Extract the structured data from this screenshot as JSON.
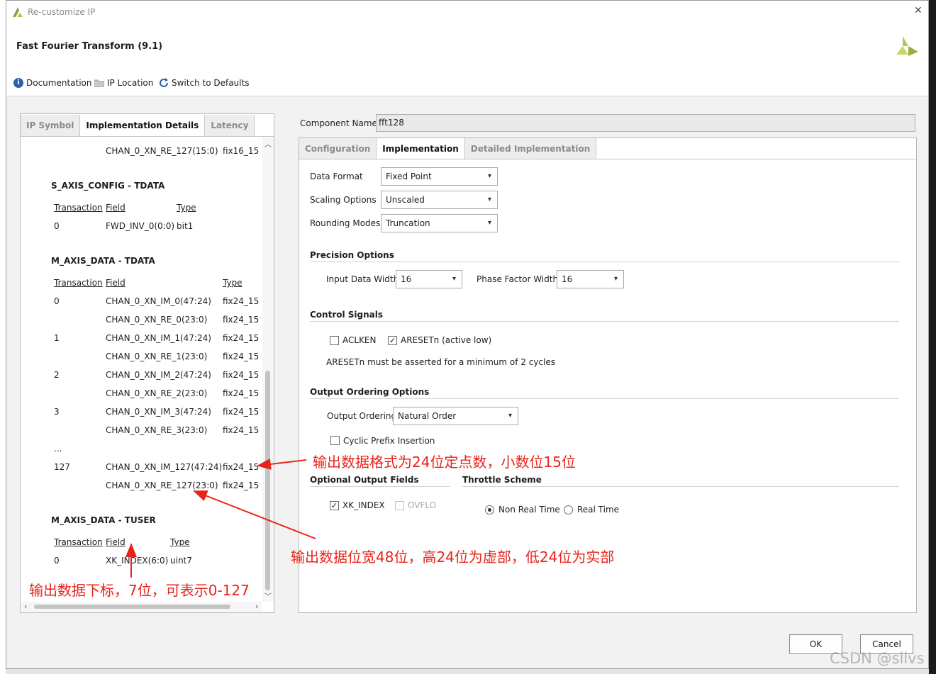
{
  "window": {
    "title": "Re-customize IP",
    "close": "✕",
    "heading": "Fast Fourier Transform (9.1)"
  },
  "toolbar": {
    "documentation": "Documentation",
    "ip_location": "IP Location",
    "switch_defaults": "Switch to Defaults"
  },
  "left": {
    "tabs": [
      "IP Symbol",
      "Implementation Details",
      "Latency"
    ],
    "active_tab": "Implementation Details",
    "top_row": {
      "field": "CHAN_0_XN_RE_127(15:0)",
      "type": "fix16_15"
    },
    "config_section": {
      "title": "S_AXIS_CONFIG - TDATA",
      "headers": [
        "Transaction",
        "Field",
        "Type"
      ],
      "rows": [
        {
          "txn": "0",
          "field": "FWD_INV_0(0:0)",
          "type": "bit1"
        }
      ]
    },
    "data_section": {
      "title": "M_AXIS_DATA - TDATA",
      "headers": [
        "Transaction",
        "Field",
        "Type"
      ],
      "rows": [
        {
          "txn": "0",
          "field": "CHAN_0_XN_IM_0(47:24)",
          "type": "fix24_15"
        },
        {
          "txn": "",
          "field": "CHAN_0_XN_RE_0(23:0)",
          "type": "fix24_15"
        },
        {
          "txn": "1",
          "field": "CHAN_0_XN_IM_1(47:24)",
          "type": "fix24_15"
        },
        {
          "txn": "",
          "field": "CHAN_0_XN_RE_1(23:0)",
          "type": "fix24_15"
        },
        {
          "txn": "2",
          "field": "CHAN_0_XN_IM_2(47:24)",
          "type": "fix24_15"
        },
        {
          "txn": "",
          "field": "CHAN_0_XN_RE_2(23:0)",
          "type": "fix24_15"
        },
        {
          "txn": "3",
          "field": "CHAN_0_XN_IM_3(47:24)",
          "type": "fix24_15"
        },
        {
          "txn": "",
          "field": "CHAN_0_XN_RE_3(23:0)",
          "type": "fix24_15"
        },
        {
          "txn": "...",
          "field": "",
          "type": ""
        },
        {
          "txn": "127",
          "field": "CHAN_0_XN_IM_127(47:24)",
          "type": "fix24_15"
        },
        {
          "txn": "",
          "field": "CHAN_0_XN_RE_127(23:0)",
          "type": "fix24_15"
        }
      ]
    },
    "tuser_section": {
      "title": "M_AXIS_DATA - TUSER",
      "headers": [
        "Transaction",
        "Field",
        "Type"
      ],
      "rows": [
        {
          "txn": "0",
          "field": "XK_INDEX(6:0)",
          "type": "uint7"
        }
      ]
    }
  },
  "right": {
    "component_name_label": "Component Name",
    "component_name_value": "fft128",
    "tabs": [
      "Configuration",
      "Implementation",
      "Detailed Implementation"
    ],
    "active_tab": "Implementation",
    "data_format": {
      "label": "Data Format",
      "value": "Fixed Point"
    },
    "scaling": {
      "label": "Scaling Options",
      "value": "Unscaled"
    },
    "rounding": {
      "label": "Rounding Modes",
      "value": "Truncation"
    },
    "precision": {
      "title": "Precision Options",
      "input_width_label": "Input Data Width",
      "input_width": "16",
      "phase_width_label": "Phase Factor Width",
      "phase_width": "16"
    },
    "control": {
      "title": "Control Signals",
      "aclken": {
        "label": "ACLKEN",
        "checked": false
      },
      "aresetn": {
        "label": "ARESETn (active low)",
        "checked": true
      },
      "note": "ARESETn must be asserted for a minimum of 2 cycles"
    },
    "ordering": {
      "title": "Output Ordering Options",
      "label": "Output Ordering",
      "value": "Natural Order",
      "cyclic": {
        "label": "Cyclic Prefix Insertion",
        "checked": false
      }
    },
    "optional": {
      "title": "Optional Output Fields",
      "xk_index": {
        "label": "XK_INDEX",
        "checked": true
      },
      "ovflo": {
        "label": "OVFLO",
        "checked": false
      }
    },
    "throttle": {
      "title": "Throttle Scheme",
      "non_real_time": "Non Real Time",
      "real_time": "Real Time",
      "selected": "Non Real Time"
    }
  },
  "buttons": {
    "ok": "OK",
    "cancel": "Cancel"
  },
  "annotations": {
    "format": "输出数据格式为24位定点数，小数位15位",
    "width": "输出数据位宽48位，高24位为虚部，低24位为实部",
    "index": "输出数据下标，7位，可表示0-127"
  },
  "watermark": "CSDN @sllvs",
  "colors": {
    "annotation": "#e8231a",
    "xilinx_logo": "#b6c94a"
  }
}
